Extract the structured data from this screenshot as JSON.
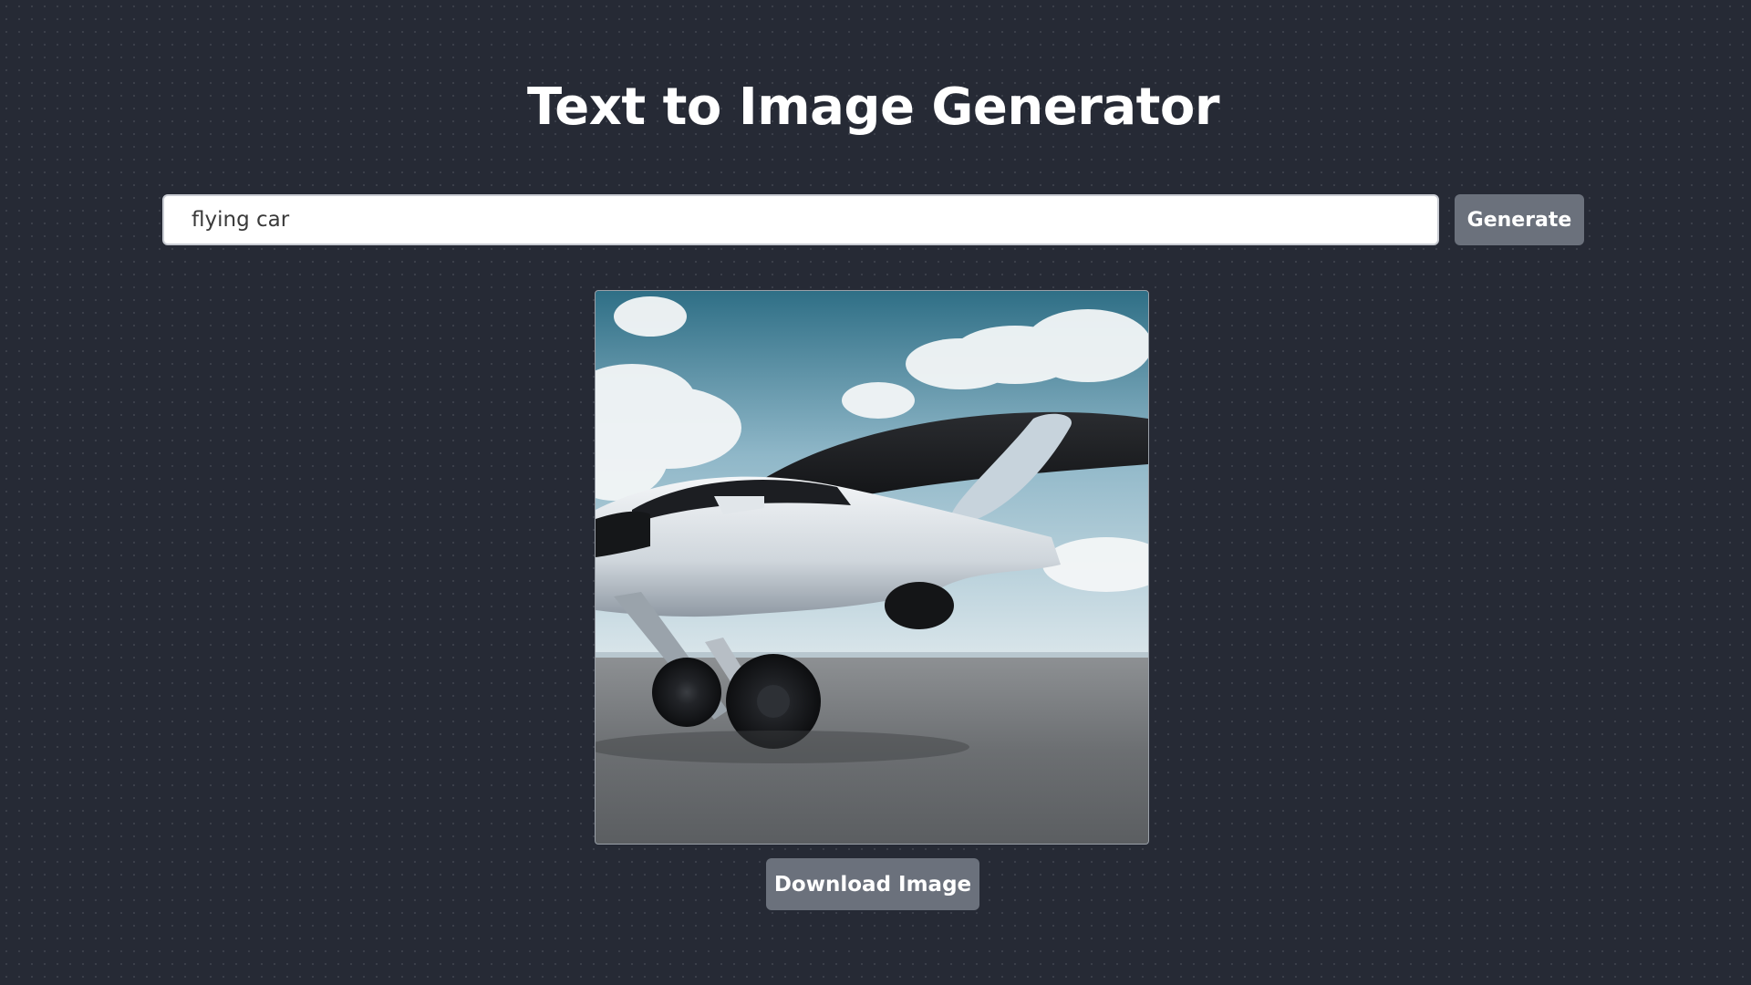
{
  "page": {
    "title": "Text to Image Generator"
  },
  "prompt": {
    "value": "flying car",
    "placeholder": ""
  },
  "actions": {
    "generate_label": "Generate",
    "download_label": "Download Image"
  },
  "generated_image": {
    "alt": "flying car"
  },
  "colors": {
    "background": "#262a35",
    "button": "#6b717c",
    "input_background": "#ffffff",
    "title_text": "#ffffff"
  }
}
